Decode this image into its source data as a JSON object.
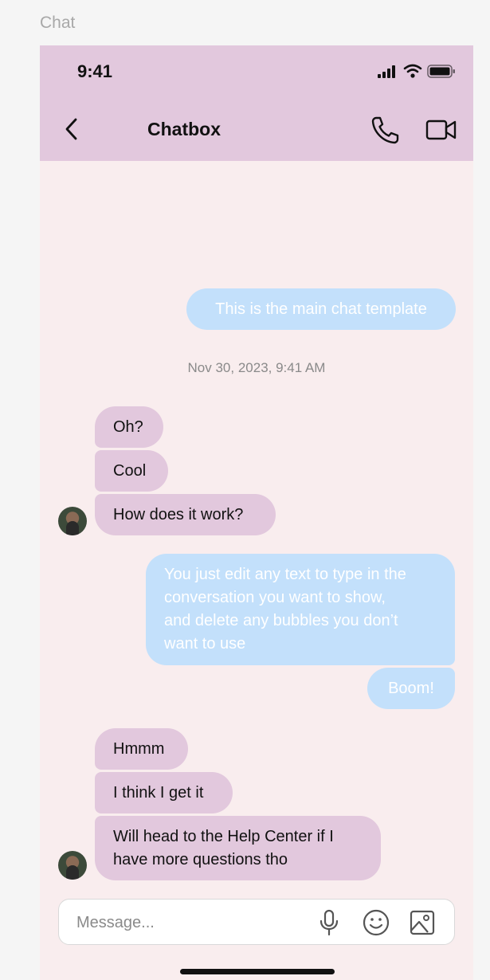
{
  "frame_label": "Chat",
  "status_bar": {
    "time": "9:41"
  },
  "header": {
    "title": "Chatbox"
  },
  "timestamp": "Nov 30, 2023, 9:41 AM",
  "messages": {
    "m1": "This is the main chat template",
    "m2": "Oh?",
    "m3": "Cool",
    "m4": "How does it work?",
    "m5_line1": "You just edit any text to type in the",
    "m5_line2": "conversation you want to show,",
    "m5_line3": "and delete any bubbles you don’t",
    "m5_line4": "want to use",
    "m6": "Boom!",
    "m7": "Hmmm",
    "m8": "I think I get it",
    "m9_line1": "Will head to the Help Center if I",
    "m9_line2": "have more questions tho"
  },
  "composer": {
    "placeholder": "Message...",
    "value": ""
  },
  "colors": {
    "header_bg": "#e2c8dd",
    "chat_bg": "#f9edee",
    "outgoing_bubble": "#c3e0fb",
    "incoming_bubble": "#e2c8dd"
  },
  "icons": {
    "back": "chevron-left-icon",
    "call": "phone-icon",
    "video": "video-camera-icon",
    "mic": "microphone-icon",
    "emoji": "smiley-icon",
    "image": "image-icon",
    "signal": "cellular-signal-icon",
    "wifi": "wifi-icon",
    "battery": "battery-icon"
  }
}
